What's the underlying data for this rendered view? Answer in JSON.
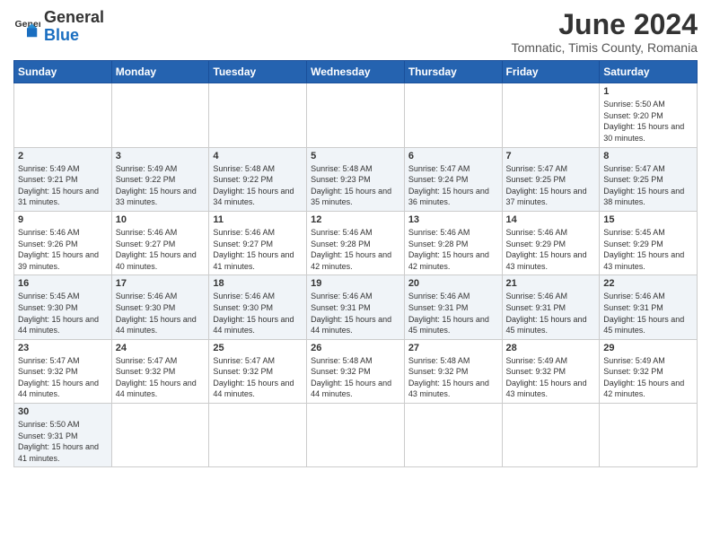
{
  "header": {
    "logo_general": "General",
    "logo_blue": "Blue",
    "month_year": "June 2024",
    "location": "Tomnatic, Timis County, Romania"
  },
  "days_of_week": [
    "Sunday",
    "Monday",
    "Tuesday",
    "Wednesday",
    "Thursday",
    "Friday",
    "Saturday"
  ],
  "weeks": [
    [
      null,
      null,
      null,
      null,
      null,
      null,
      {
        "day": "1",
        "sunrise": "Sunrise: 5:50 AM",
        "sunset": "Sunset: 9:20 PM",
        "daylight": "Daylight: 15 hours and 30 minutes."
      }
    ],
    [
      {
        "day": "2",
        "sunrise": "Sunrise: 5:49 AM",
        "sunset": "Sunset: 9:21 PM",
        "daylight": "Daylight: 15 hours and 31 minutes."
      },
      {
        "day": "3",
        "sunrise": "Sunrise: 5:49 AM",
        "sunset": "Sunset: 9:22 PM",
        "daylight": "Daylight: 15 hours and 33 minutes."
      },
      {
        "day": "4",
        "sunrise": "Sunrise: 5:48 AM",
        "sunset": "Sunset: 9:22 PM",
        "daylight": "Daylight: 15 hours and 34 minutes."
      },
      {
        "day": "5",
        "sunrise": "Sunrise: 5:48 AM",
        "sunset": "Sunset: 9:23 PM",
        "daylight": "Daylight: 15 hours and 35 minutes."
      },
      {
        "day": "6",
        "sunrise": "Sunrise: 5:47 AM",
        "sunset": "Sunset: 9:24 PM",
        "daylight": "Daylight: 15 hours and 36 minutes."
      },
      {
        "day": "7",
        "sunrise": "Sunrise: 5:47 AM",
        "sunset": "Sunset: 9:25 PM",
        "daylight": "Daylight: 15 hours and 37 minutes."
      },
      {
        "day": "8",
        "sunrise": "Sunrise: 5:47 AM",
        "sunset": "Sunset: 9:25 PM",
        "daylight": "Daylight: 15 hours and 38 minutes."
      }
    ],
    [
      {
        "day": "9",
        "sunrise": "Sunrise: 5:46 AM",
        "sunset": "Sunset: 9:26 PM",
        "daylight": "Daylight: 15 hours and 39 minutes."
      },
      {
        "day": "10",
        "sunrise": "Sunrise: 5:46 AM",
        "sunset": "Sunset: 9:27 PM",
        "daylight": "Daylight: 15 hours and 40 minutes."
      },
      {
        "day": "11",
        "sunrise": "Sunrise: 5:46 AM",
        "sunset": "Sunset: 9:27 PM",
        "daylight": "Daylight: 15 hours and 41 minutes."
      },
      {
        "day": "12",
        "sunrise": "Sunrise: 5:46 AM",
        "sunset": "Sunset: 9:28 PM",
        "daylight": "Daylight: 15 hours and 42 minutes."
      },
      {
        "day": "13",
        "sunrise": "Sunrise: 5:46 AM",
        "sunset": "Sunset: 9:28 PM",
        "daylight": "Daylight: 15 hours and 42 minutes."
      },
      {
        "day": "14",
        "sunrise": "Sunrise: 5:46 AM",
        "sunset": "Sunset: 9:29 PM",
        "daylight": "Daylight: 15 hours and 43 minutes."
      },
      {
        "day": "15",
        "sunrise": "Sunrise: 5:45 AM",
        "sunset": "Sunset: 9:29 PM",
        "daylight": "Daylight: 15 hours and 43 minutes."
      }
    ],
    [
      {
        "day": "16",
        "sunrise": "Sunrise: 5:45 AM",
        "sunset": "Sunset: 9:30 PM",
        "daylight": "Daylight: 15 hours and 44 minutes."
      },
      {
        "day": "17",
        "sunrise": "Sunrise: 5:46 AM",
        "sunset": "Sunset: 9:30 PM",
        "daylight": "Daylight: 15 hours and 44 minutes."
      },
      {
        "day": "18",
        "sunrise": "Sunrise: 5:46 AM",
        "sunset": "Sunset: 9:30 PM",
        "daylight": "Daylight: 15 hours and 44 minutes."
      },
      {
        "day": "19",
        "sunrise": "Sunrise: 5:46 AM",
        "sunset": "Sunset: 9:31 PM",
        "daylight": "Daylight: 15 hours and 44 minutes."
      },
      {
        "day": "20",
        "sunrise": "Sunrise: 5:46 AM",
        "sunset": "Sunset: 9:31 PM",
        "daylight": "Daylight: 15 hours and 45 minutes."
      },
      {
        "day": "21",
        "sunrise": "Sunrise: 5:46 AM",
        "sunset": "Sunset: 9:31 PM",
        "daylight": "Daylight: 15 hours and 45 minutes."
      },
      {
        "day": "22",
        "sunrise": "Sunrise: 5:46 AM",
        "sunset": "Sunset: 9:31 PM",
        "daylight": "Daylight: 15 hours and 45 minutes."
      }
    ],
    [
      {
        "day": "23",
        "sunrise": "Sunrise: 5:47 AM",
        "sunset": "Sunset: 9:32 PM",
        "daylight": "Daylight: 15 hours and 44 minutes."
      },
      {
        "day": "24",
        "sunrise": "Sunrise: 5:47 AM",
        "sunset": "Sunset: 9:32 PM",
        "daylight": "Daylight: 15 hours and 44 minutes."
      },
      {
        "day": "25",
        "sunrise": "Sunrise: 5:47 AM",
        "sunset": "Sunset: 9:32 PM",
        "daylight": "Daylight: 15 hours and 44 minutes."
      },
      {
        "day": "26",
        "sunrise": "Sunrise: 5:48 AM",
        "sunset": "Sunset: 9:32 PM",
        "daylight": "Daylight: 15 hours and 44 minutes."
      },
      {
        "day": "27",
        "sunrise": "Sunrise: 5:48 AM",
        "sunset": "Sunset: 9:32 PM",
        "daylight": "Daylight: 15 hours and 43 minutes."
      },
      {
        "day": "28",
        "sunrise": "Sunrise: 5:49 AM",
        "sunset": "Sunset: 9:32 PM",
        "daylight": "Daylight: 15 hours and 43 minutes."
      },
      {
        "day": "29",
        "sunrise": "Sunrise: 5:49 AM",
        "sunset": "Sunset: 9:32 PM",
        "daylight": "Daylight: 15 hours and 42 minutes."
      }
    ],
    [
      {
        "day": "30",
        "sunrise": "Sunrise: 5:50 AM",
        "sunset": "Sunset: 9:31 PM",
        "daylight": "Daylight: 15 hours and 41 minutes."
      },
      null,
      null,
      null,
      null,
      null,
      null
    ]
  ]
}
